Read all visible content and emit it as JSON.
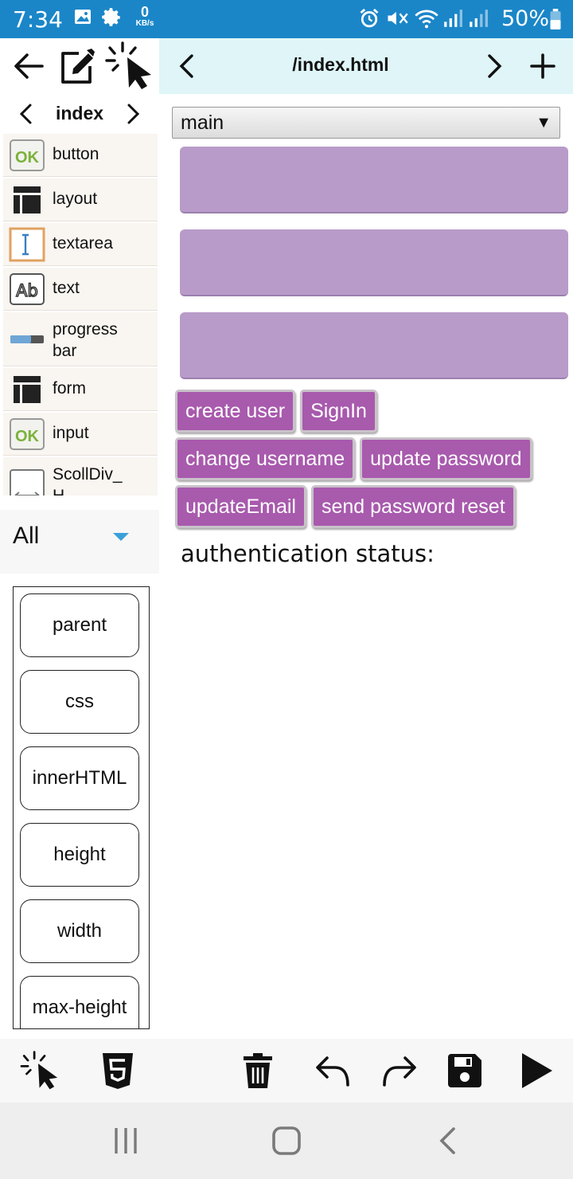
{
  "status_bar": {
    "time": "7:34",
    "net_speed_value": "0",
    "net_speed_unit": "KB/s",
    "battery": "50%",
    "icons": [
      "gallery-icon",
      "settings-icon",
      "alarm-icon",
      "mute-icon",
      "wifi-icon",
      "signal-icon",
      "signal-icon-2",
      "battery-icon"
    ]
  },
  "toolbar": {
    "path": "/index.html",
    "icons": [
      "back-arrow-icon",
      "edit-icon",
      "select-pointer-icon",
      "chevron-left-icon",
      "chevron-right-icon",
      "plus-icon"
    ]
  },
  "palette": {
    "page_label": "index",
    "items": [
      {
        "label": "button",
        "icon": "ok-button-icon"
      },
      {
        "label": "layout",
        "icon": "layout-icon"
      },
      {
        "label": "textarea",
        "icon": "textarea-icon"
      },
      {
        "label": "text",
        "icon": "text-ab-icon"
      },
      {
        "label": "progress\nbar",
        "icon": "progress-bar-icon"
      },
      {
        "label": "form",
        "icon": "layout-icon"
      },
      {
        "label": "input",
        "icon": "ok-button-icon"
      },
      {
        "label": "ScollDiv_\nH",
        "icon": "horizontal-scroll-icon"
      }
    ],
    "filter": "All"
  },
  "properties": [
    "parent",
    "css",
    "innerHTML",
    "height",
    "width",
    "max-height"
  ],
  "canvas": {
    "container_select": "main",
    "fields_count": 3,
    "buttons": [
      [
        "create user",
        "SignIn"
      ],
      [
        "change username",
        "update password"
      ],
      [
        "updateEmail",
        "send password reset"
      ]
    ],
    "status_label": "authentication status:"
  },
  "colors": {
    "status_bar": "#1a86c8",
    "toolbar_bg": "#dff5f8",
    "field_bg": "#b89bc9",
    "button_bg": "#a85aad",
    "filter_caret": "#3aa0d8"
  },
  "bottom_bar": {
    "icons": [
      "select-pointer-icon",
      "html5-icon",
      "trash-icon",
      "undo-icon",
      "redo-icon",
      "save-icon",
      "play-icon"
    ]
  },
  "nav_bar": {
    "icons": [
      "recent-apps-icon",
      "home-icon",
      "back-icon"
    ]
  }
}
